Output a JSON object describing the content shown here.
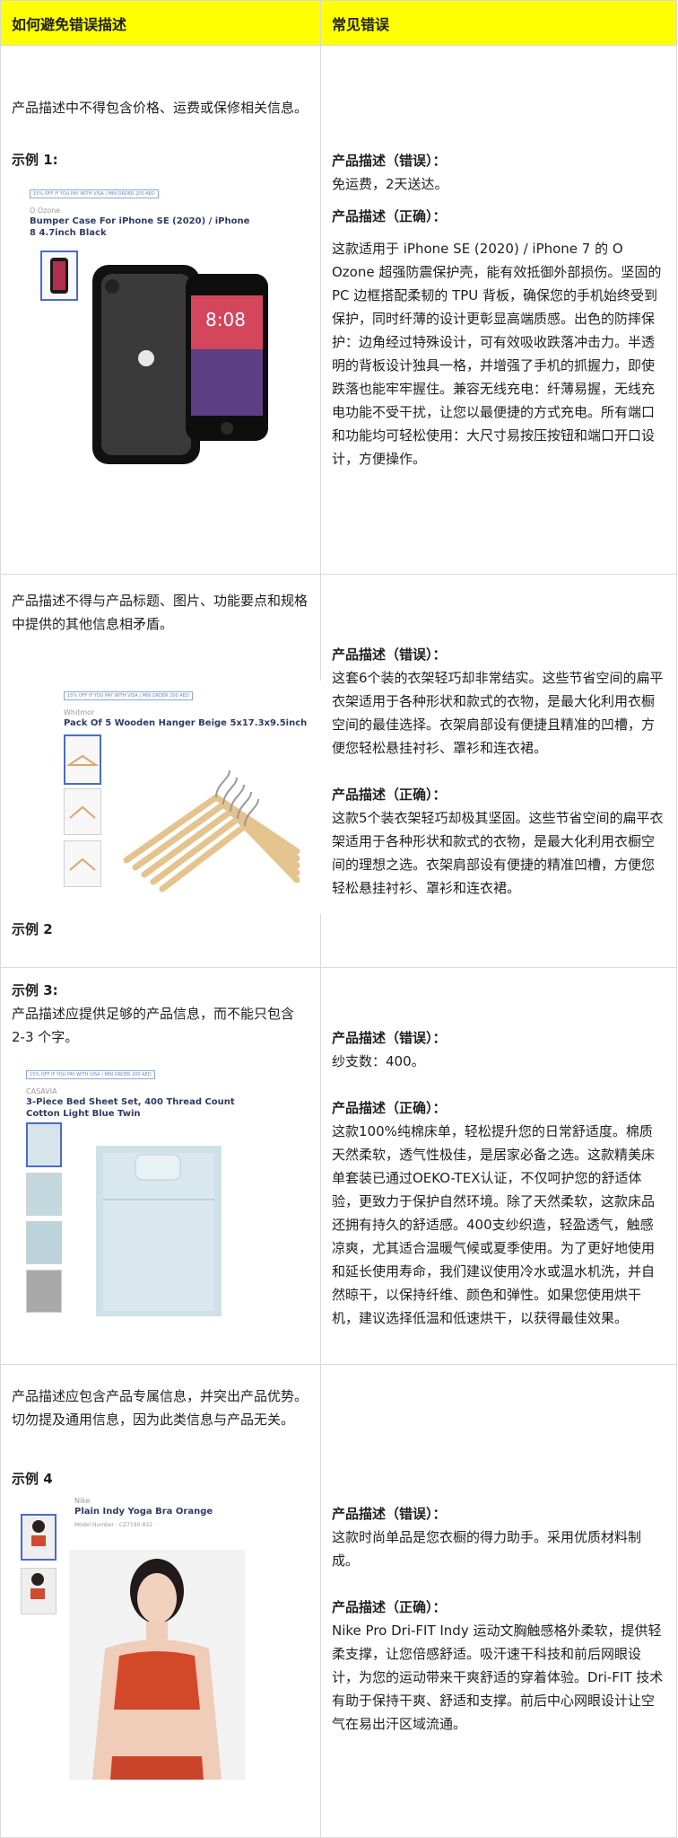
{
  "header": {
    "col1": "如何避免错误描述",
    "col2": "常见错误"
  },
  "labels": {
    "wrong": "产品描述（错误）：",
    "right": "产品描述（正确）："
  },
  "rows": [
    {
      "rule": "产品描述中不得包含价格、运费或保修相关信息。",
      "example": "示例 1:",
      "product": {
        "promo": "15% OFF IF YOU PAY WITH VISA | MIN ORDER 200 AED",
        "brand": "O Ozone",
        "title": "Bumper Case For iPhone SE (2020) / iPhone 8 4.7inch Black",
        "screen_time": "8:08"
      },
      "wrong": "免运费，2天送达。",
      "right": "这款适用于 iPhone SE (2020) / iPhone 7 的 O Ozone 超强防震保护壳，能有效抵御外部损伤。坚固的 PC 边框搭配柔韧的 TPU 背板，确保您的手机始终受到保护，同时纤薄的设计更彰显高端质感。出色的防摔保护：边角经过特殊设计，可有效吸收跌落冲击力。半透明的背板设计独具一格，并增强了手机的抓握力，即使跌落也能牢牢握住。兼容无线充电：纤薄易握，无线充电功能不受干扰，让您以最便捷的方式充电。所有端口和功能均可轻松使用：大尺寸易按压按钮和端口开口设计，方便操作。"
    },
    {
      "rule": "产品描述不得与产品标题、图片、功能要点和规格中提供的其他信息相矛盾。",
      "example": "示例 2",
      "product": {
        "promo": "15% OFF IF YOU PAY WITH VISA | MIN ORDER 200 AED",
        "brand": "Whitmor",
        "title": "Pack Of 5 Wooden Hanger Beige 5x17.3x9.5inch"
      },
      "wrong": "这套6个装的衣架轻巧却非常结实。这些节省空间的扁平衣架适用于各种形状和款式的衣物，是最大化利用衣橱空间的最佳选择。衣架肩部设有便捷且精准的凹槽，方便您轻松悬挂衬衫、罩衫和连衣裙。",
      "right": "这款5个装衣架轻巧却极其坚固。这些节省空间的扁平衣架适用于各种形状和款式的衣物，是最大化利用衣橱空间的理想之选。衣架肩部设有便捷的精准凹槽，方便您轻松悬挂衬衫、罩衫和连衣裙。"
    },
    {
      "rule": "产品描述应提供足够的产品信息，而不能只包含 2-3 个字。",
      "example": "示例 3:",
      "product": {
        "promo": "15% OFF IF YOU PAY WITH VISA | MIN ORDER 200 AED",
        "brand": "CASAVIA",
        "title": "3-Piece Bed Sheet Set, 400 Thread Count Cotton Light Blue Twin"
      },
      "wrong": "纱支数：400。",
      "right": "这款100%纯棉床单，轻松提升您的日常舒适度。棉质天然柔软，透气性极佳，是居家必备之选。这款精美床单套装已通过OEKO-TEX认证，不仅呵护您的舒适体验，更致力于保护自然环境。除了天然柔软，这款床品还拥有持久的舒适感。400支纱织造，轻盈透气，触感凉爽，尤其适合温暖气候或夏季使用。为了更好地使用和延长使用寿命，我们建议使用冷水或温水机洗，并自然晾干，以保持纤维、颜色和弹性。如果您使用烘干机，建议选择低温和低速烘干，以获得最佳效果。"
    },
    {
      "rule": "产品描述应包含产品专属信息，并突出产品优势。切勿提及通用信息，因为此类信息与产品无关。",
      "example": "示例 4",
      "product": {
        "brand": "Nike",
        "title": "Plain Indy Yoga Bra Orange",
        "model": "Model Number : CZ7190-832"
      },
      "wrong": "这款时尚单品是您衣橱的得力助手。采用优质材料制成。",
      "right": "Nike Pro Dri-FIT Indy 运动文胸触感格外柔软，提供轻柔支撑，让您倍感舒适。吸汗速干科技和前后网眼设计，为您的运动带来干爽舒适的穿着体验。Dri-FIT 技术有助于保持干爽、舒适和支撑。前后中心网眼设计让空气在易出汗区域流通。"
    }
  ],
  "colors": {
    "header_bg": "#ffff00",
    "border": "#d9d9d9",
    "title_blue": "#2f3b64",
    "promo_blue": "#6d86c2"
  }
}
